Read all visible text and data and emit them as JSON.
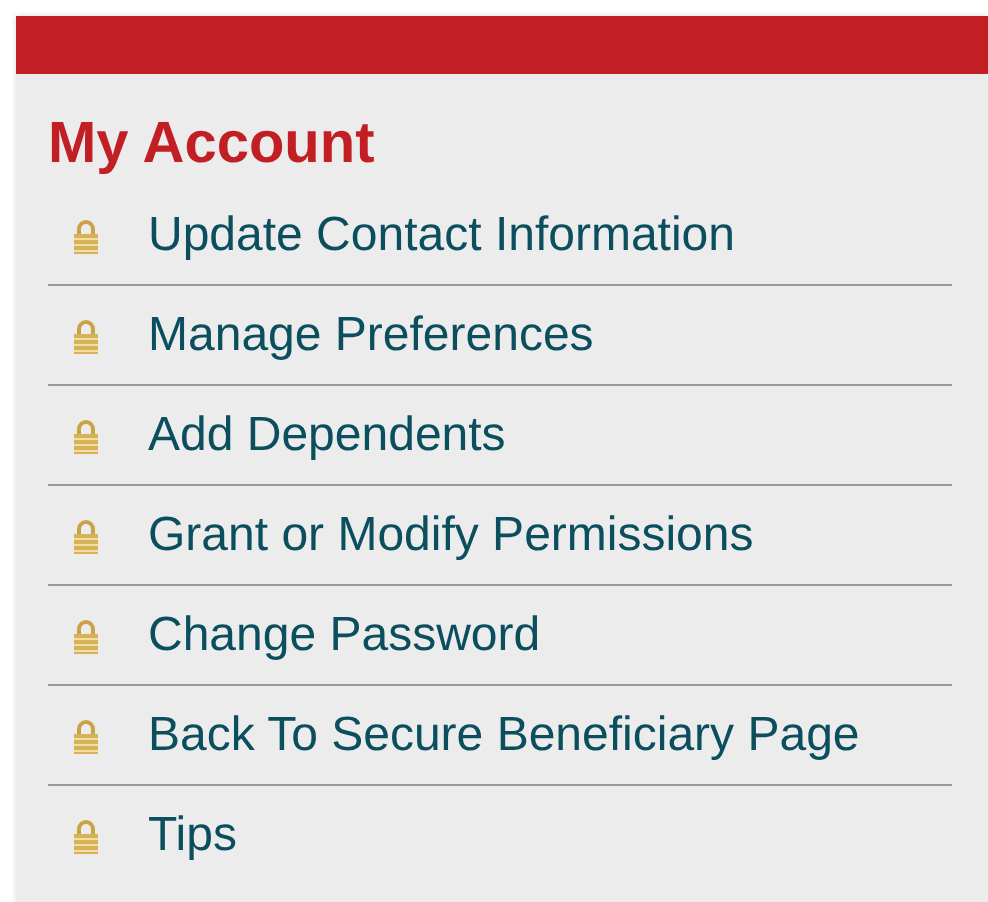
{
  "header": {
    "title": "My Account"
  },
  "links": [
    {
      "label": "Update Contact Information"
    },
    {
      "label": "Manage Preferences"
    },
    {
      "label": "Add Dependents"
    },
    {
      "label": "Grant or Modify Permissions"
    },
    {
      "label": "Change Password"
    },
    {
      "label": "Back To Secure Beneficiary Page"
    },
    {
      "label": "Tips"
    }
  ]
}
